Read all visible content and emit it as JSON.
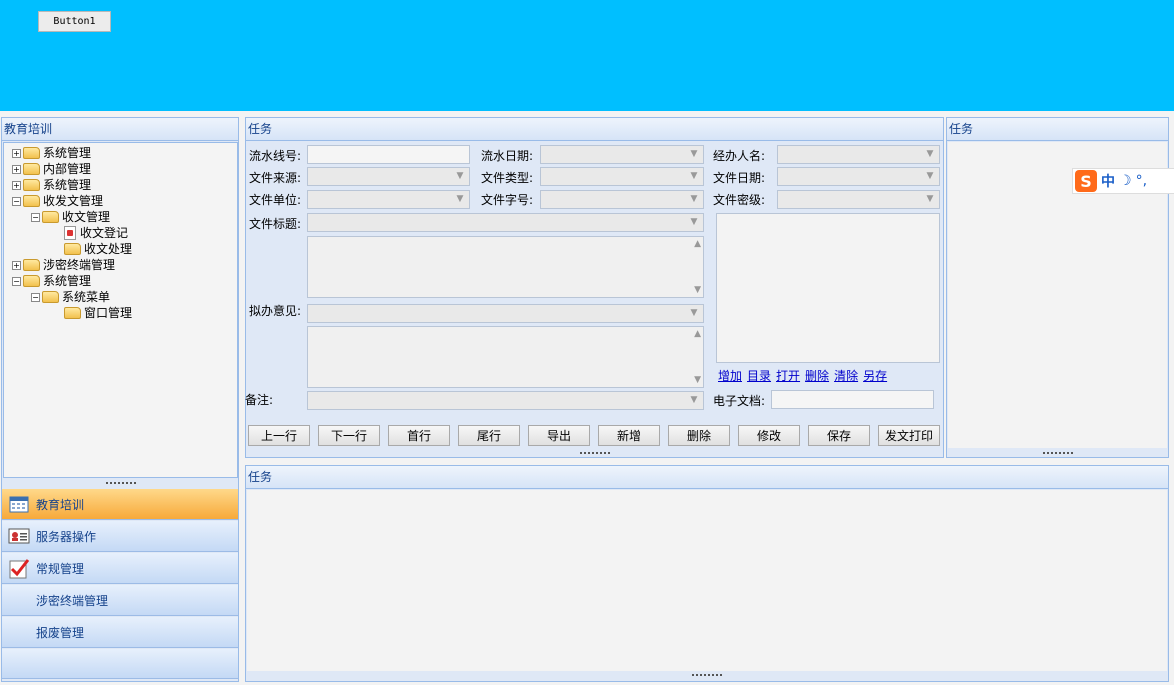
{
  "top": {
    "button_label": "Button1"
  },
  "left_panel": {
    "title": "教育培训",
    "tree": [
      {
        "label": "系统管理"
      },
      {
        "label": "内部管理"
      },
      {
        "label": "系统管理"
      },
      {
        "label": "收发文管理"
      },
      {
        "label": "收文管理"
      },
      {
        "label": "收文登记"
      },
      {
        "label": "收文处理"
      },
      {
        "label": "涉密终端管理"
      },
      {
        "label": "系统管理"
      },
      {
        "label": "系统菜单"
      },
      {
        "label": "窗口管理"
      }
    ],
    "nav": [
      {
        "label": "教育培训",
        "icon": "calendar-icon"
      },
      {
        "label": "服务器操作",
        "icon": "id-card-icon"
      },
      {
        "label": "常规管理",
        "icon": "checklist-icon"
      },
      {
        "label": "涉密终端管理",
        "icon": ""
      },
      {
        "label": "报废管理",
        "icon": ""
      }
    ]
  },
  "task_form": {
    "title": "任务",
    "labels": {
      "serial_no": "流水线号:",
      "serial_date": "流水日期:",
      "handler": "经办人名:",
      "doc_source": "文件来源:",
      "doc_type": "文件类型:",
      "doc_date": "文件日期:",
      "doc_unit": "文件单位:",
      "doc_number": "文件字号:",
      "doc_secret": "文件密级:",
      "doc_title": "文件标题:",
      "opinion": "拟办意见:",
      "remark": "备注:",
      "e_doc": "电子文档:"
    },
    "links": [
      "增加",
      "目录",
      "打开",
      "删除",
      "清除",
      "另存"
    ],
    "buttons": [
      "上一行",
      "下一行",
      "首行",
      "尾行",
      "导出",
      "新增",
      "删除",
      "修改",
      "保存",
      "发文打印"
    ]
  },
  "right_panel": {
    "title": "任务"
  },
  "bottom_panel": {
    "title": "任务"
  },
  "ime": {
    "label": "中"
  }
}
